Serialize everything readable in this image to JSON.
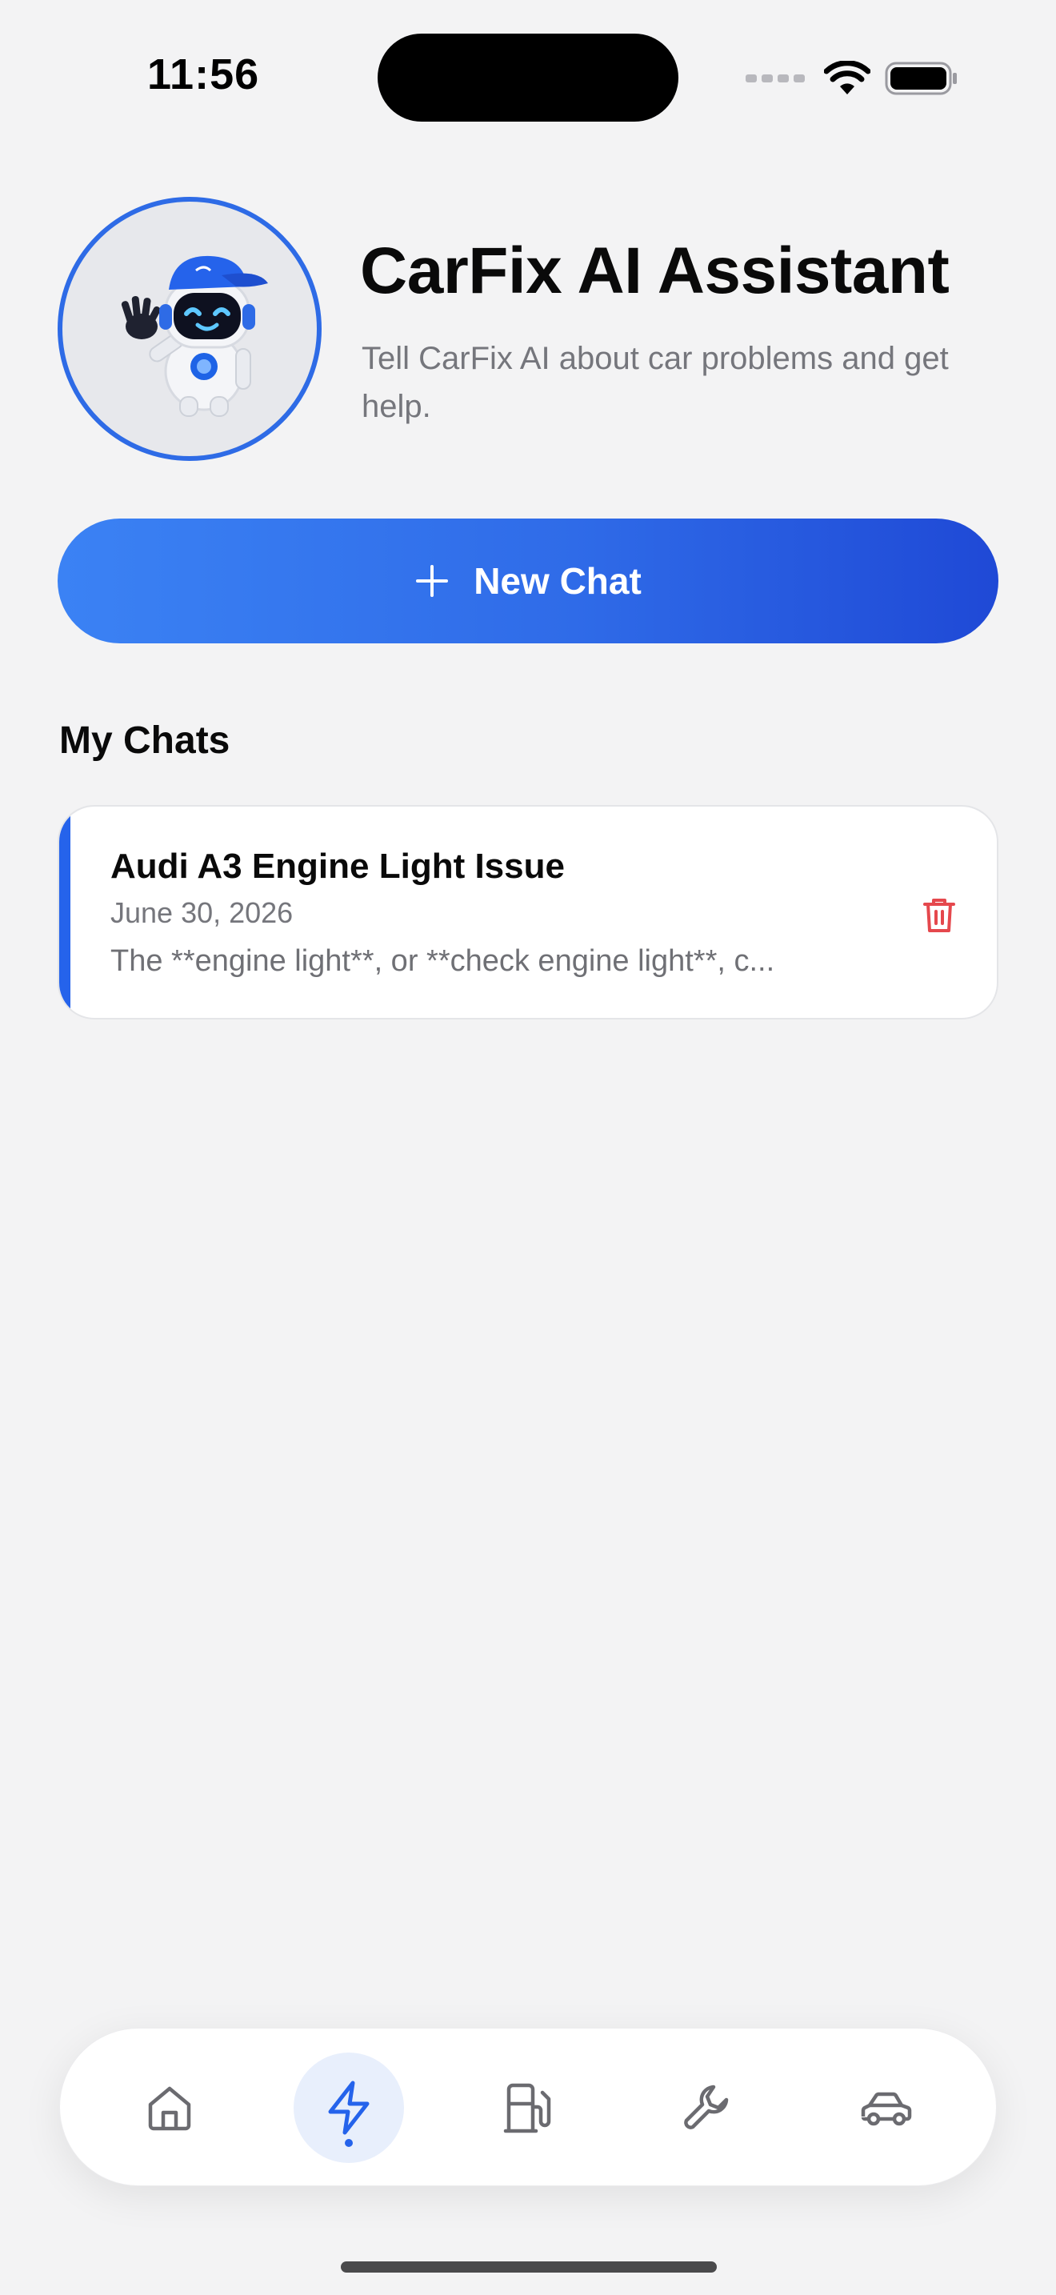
{
  "status_bar": {
    "time": "11:56"
  },
  "header": {
    "title": "CarFix AI Assistant",
    "subtitle": "Tell CarFix AI about car problems and get help.",
    "avatar_icon": "robot-mascot-icon"
  },
  "new_chat": {
    "label": "New Chat",
    "icon": "plus-icon"
  },
  "chats_section": {
    "title": "My Chats",
    "items": [
      {
        "title": "Audi A3 Engine Light Issue",
        "date": "June 30, 2026",
        "preview": "The **engine light**, or **check engine light**, c..."
      }
    ]
  },
  "tab_bar": {
    "tabs": [
      {
        "icon": "home-icon",
        "active": false
      },
      {
        "icon": "lightning-icon",
        "active": true
      },
      {
        "icon": "fuel-pump-icon",
        "active": false
      },
      {
        "icon": "wrench-icon",
        "active": false
      },
      {
        "icon": "car-icon",
        "active": false
      }
    ]
  },
  "colors": {
    "accent": "#2563EB",
    "delete": "#E5484D",
    "background": "#F3F3F4"
  }
}
